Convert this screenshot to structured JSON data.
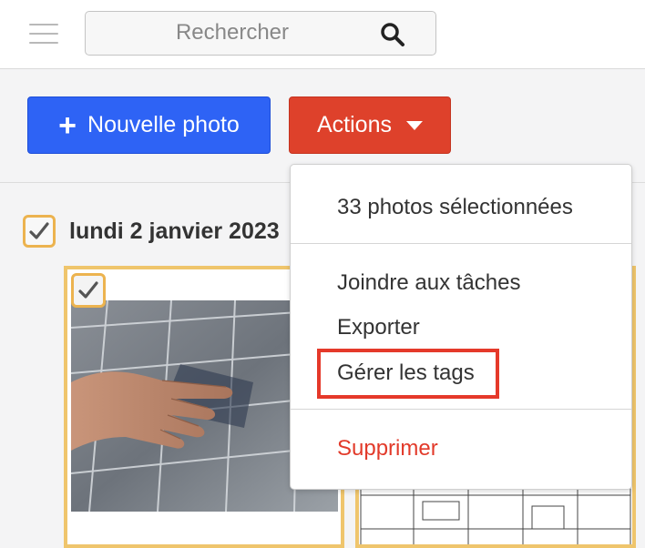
{
  "topbar": {
    "menu_icon": "hamburger-menu-icon",
    "search": {
      "placeholder": "Rechercher",
      "value": "",
      "icon": "search-icon"
    }
  },
  "toolbar": {
    "new_photo_label": "Nouvelle photo",
    "new_photo_icon": "plus-icon",
    "actions_label": "Actions",
    "actions_icon": "caret-down-icon",
    "colors": {
      "new_photo": "#2e63f5",
      "actions": "#de412b"
    }
  },
  "group": {
    "date_label": "lundi 2 janvier 2023",
    "checked": true,
    "photos": [
      {
        "checked": true,
        "icon": "photo-thumbnail"
      },
      {
        "checked": true,
        "icon": "floor-plan-thumbnail"
      }
    ]
  },
  "dropdown": {
    "header": "33 photos sélectionnées",
    "items": [
      {
        "label": "Joindre aux tâches"
      },
      {
        "label": "Exporter"
      },
      {
        "label": "Gérer les tags",
        "highlighted": true
      },
      {
        "label": "Supprimer",
        "danger": true
      }
    ],
    "colors": {
      "danger": "#e23a2a",
      "highlight": "#e5392a"
    }
  }
}
